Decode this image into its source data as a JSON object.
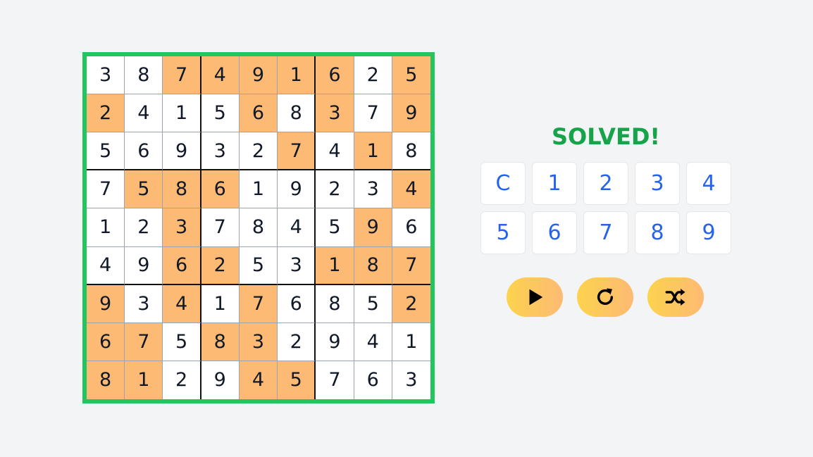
{
  "sudoku": {
    "cells": [
      [
        {
          "v": "3",
          "g": false
        },
        {
          "v": "8",
          "g": false
        },
        {
          "v": "7",
          "g": true
        },
        {
          "v": "4",
          "g": true
        },
        {
          "v": "9",
          "g": true
        },
        {
          "v": "1",
          "g": true
        },
        {
          "v": "6",
          "g": true
        },
        {
          "v": "2",
          "g": false
        },
        {
          "v": "5",
          "g": true
        }
      ],
      [
        {
          "v": "2",
          "g": true
        },
        {
          "v": "4",
          "g": false
        },
        {
          "v": "1",
          "g": false
        },
        {
          "v": "5",
          "g": false
        },
        {
          "v": "6",
          "g": true
        },
        {
          "v": "8",
          "g": false
        },
        {
          "v": "3",
          "g": true
        },
        {
          "v": "7",
          "g": false
        },
        {
          "v": "9",
          "g": true
        }
      ],
      [
        {
          "v": "5",
          "g": false
        },
        {
          "v": "6",
          "g": false
        },
        {
          "v": "9",
          "g": false
        },
        {
          "v": "3",
          "g": false
        },
        {
          "v": "2",
          "g": false
        },
        {
          "v": "7",
          "g": true
        },
        {
          "v": "4",
          "g": false
        },
        {
          "v": "1",
          "g": true
        },
        {
          "v": "8",
          "g": false
        }
      ],
      [
        {
          "v": "7",
          "g": false
        },
        {
          "v": "5",
          "g": true
        },
        {
          "v": "8",
          "g": true
        },
        {
          "v": "6",
          "g": true
        },
        {
          "v": "1",
          "g": false
        },
        {
          "v": "9",
          "g": false
        },
        {
          "v": "2",
          "g": false
        },
        {
          "v": "3",
          "g": false
        },
        {
          "v": "4",
          "g": true
        }
      ],
      [
        {
          "v": "1",
          "g": false
        },
        {
          "v": "2",
          "g": false
        },
        {
          "v": "3",
          "g": true
        },
        {
          "v": "7",
          "g": false
        },
        {
          "v": "8",
          "g": false
        },
        {
          "v": "4",
          "g": false
        },
        {
          "v": "5",
          "g": false
        },
        {
          "v": "9",
          "g": true
        },
        {
          "v": "6",
          "g": false
        }
      ],
      [
        {
          "v": "4",
          "g": false
        },
        {
          "v": "9",
          "g": false
        },
        {
          "v": "6",
          "g": true
        },
        {
          "v": "2",
          "g": true
        },
        {
          "v": "5",
          "g": false
        },
        {
          "v": "3",
          "g": false
        },
        {
          "v": "1",
          "g": true
        },
        {
          "v": "8",
          "g": true
        },
        {
          "v": "7",
          "g": true
        }
      ],
      [
        {
          "v": "9",
          "g": true
        },
        {
          "v": "3",
          "g": false
        },
        {
          "v": "4",
          "g": true
        },
        {
          "v": "1",
          "g": false
        },
        {
          "v": "7",
          "g": true
        },
        {
          "v": "6",
          "g": false
        },
        {
          "v": "8",
          "g": false
        },
        {
          "v": "5",
          "g": false
        },
        {
          "v": "2",
          "g": true
        }
      ],
      [
        {
          "v": "6",
          "g": true
        },
        {
          "v": "7",
          "g": true
        },
        {
          "v": "5",
          "g": false
        },
        {
          "v": "8",
          "g": true
        },
        {
          "v": "3",
          "g": true
        },
        {
          "v": "2",
          "g": false
        },
        {
          "v": "9",
          "g": false
        },
        {
          "v": "4",
          "g": false
        },
        {
          "v": "1",
          "g": false
        }
      ],
      [
        {
          "v": "8",
          "g": true
        },
        {
          "v": "1",
          "g": true
        },
        {
          "v": "2",
          "g": false
        },
        {
          "v": "9",
          "g": false
        },
        {
          "v": "4",
          "g": true
        },
        {
          "v": "5",
          "g": true
        },
        {
          "v": "7",
          "g": false
        },
        {
          "v": "6",
          "g": false
        },
        {
          "v": "3",
          "g": false
        }
      ]
    ]
  },
  "panel": {
    "status": "SOLVED!",
    "keys": [
      "C",
      "1",
      "2",
      "3",
      "4",
      "5",
      "6",
      "7",
      "8",
      "9"
    ],
    "actions": [
      {
        "name": "play-button",
        "icon": "play-icon"
      },
      {
        "name": "restart-button",
        "icon": "redo-icon"
      },
      {
        "name": "shuffle-button",
        "icon": "shuffle-icon"
      }
    ]
  },
  "colors": {
    "board_border": "#22c55e",
    "given_cell": "#fdba74",
    "status": "#16a34a",
    "key_text": "#2563eb",
    "action_gradient_start": "#fcd34d",
    "action_gradient_end": "#fdba74"
  }
}
